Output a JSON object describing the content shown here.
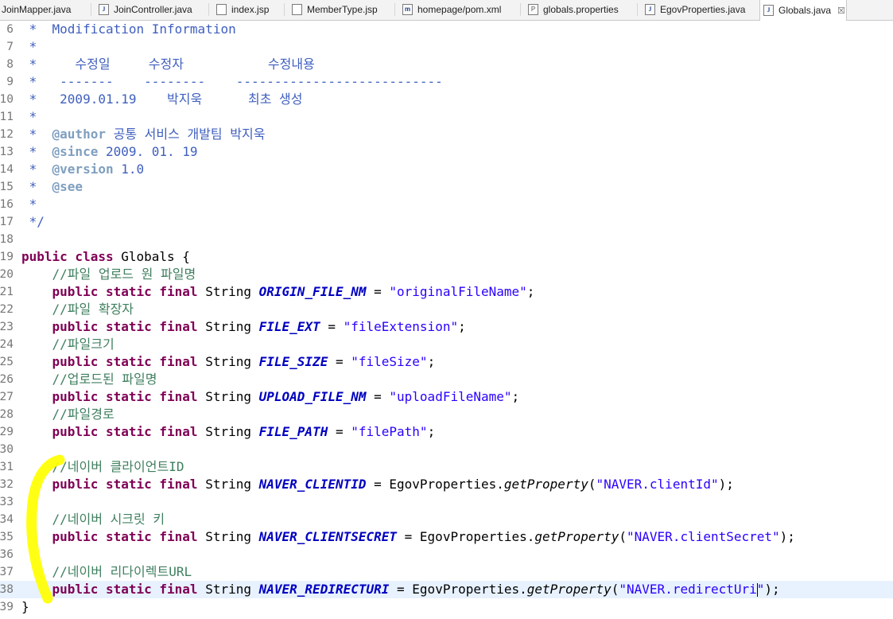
{
  "tabs": [
    {
      "label": "JoinMapper.java",
      "icon": "java-file-icon",
      "kind": "java",
      "active": false
    },
    {
      "label": "JoinController.java",
      "icon": "java-file-icon",
      "kind": "java",
      "active": false
    },
    {
      "label": "index.jsp",
      "icon": "jsp-file-icon",
      "kind": "jsp",
      "active": false
    },
    {
      "label": "MemberType.jsp",
      "icon": "jsp-file-icon",
      "kind": "jsp",
      "active": false
    },
    {
      "label": "homepage/pom.xml",
      "icon": "maven-file-icon",
      "kind": "maven",
      "active": false
    },
    {
      "label": "globals.properties",
      "icon": "properties-file-icon",
      "kind": "props",
      "active": false
    },
    {
      "label": "EgovProperties.java",
      "icon": "java-file-icon",
      "kind": "java",
      "active": false
    },
    {
      "label": "Globals.java",
      "icon": "java-file-icon",
      "kind": "java",
      "active": true,
      "close": "☒"
    }
  ],
  "editor": {
    "current_line": "38",
    "caret_after": "NAVER.redirectUri",
    "annotation_color": "#ffff00",
    "lines": [
      {
        "n": "6",
        "tokens": [
          {
            "t": " *  ",
            "c": "cm"
          },
          {
            "t": "Modification Information",
            "c": "cm"
          }
        ]
      },
      {
        "n": "7",
        "tokens": [
          {
            "t": " *",
            "c": "cm"
          }
        ]
      },
      {
        "n": "8",
        "tokens": [
          {
            "t": " *     수정일     수정자           수정내용",
            "c": "cm"
          }
        ]
      },
      {
        "n": "9",
        "tokens": [
          {
            "t": " *   -------    --------    ---------------------------",
            "c": "cm"
          }
        ]
      },
      {
        "n": "10",
        "tokens": [
          {
            "t": " *   2009.01.19    박지욱      최초 생성",
            "c": "cm"
          }
        ]
      },
      {
        "n": "11",
        "tokens": [
          {
            "t": " *",
            "c": "cm"
          }
        ]
      },
      {
        "n": "12",
        "tokens": [
          {
            "t": " *  ",
            "c": "cm"
          },
          {
            "t": "@author",
            "c": "ct"
          },
          {
            "t": " 공통 서비스 개발팀 박지욱",
            "c": "cm"
          }
        ]
      },
      {
        "n": "13",
        "tokens": [
          {
            "t": " *  ",
            "c": "cm"
          },
          {
            "t": "@since",
            "c": "ct"
          },
          {
            "t": " 2009. 01. 19",
            "c": "cm"
          }
        ]
      },
      {
        "n": "14",
        "tokens": [
          {
            "t": " *  ",
            "c": "cm"
          },
          {
            "t": "@version",
            "c": "ct"
          },
          {
            "t": " 1.0",
            "c": "cm"
          }
        ]
      },
      {
        "n": "15",
        "tokens": [
          {
            "t": " *  ",
            "c": "cm"
          },
          {
            "t": "@see",
            "c": "ct"
          }
        ]
      },
      {
        "n": "16",
        "tokens": [
          {
            "t": " *",
            "c": "cm"
          }
        ]
      },
      {
        "n": "17",
        "tokens": [
          {
            "t": " */",
            "c": "cm"
          }
        ]
      },
      {
        "n": "18",
        "tokens": []
      },
      {
        "n": "19",
        "tokens": [
          {
            "t": "public class",
            "c": "kw"
          },
          {
            "t": " Globals {",
            "c": "pl"
          }
        ]
      },
      {
        "n": "20",
        "tokens": [
          {
            "t": "    //파일 업로드 원 파일명",
            "c": "lc"
          }
        ]
      },
      {
        "n": "21",
        "tokens": [
          {
            "t": "    ",
            "c": "pl"
          },
          {
            "t": "public static final",
            "c": "kw"
          },
          {
            "t": " String ",
            "c": "pl"
          },
          {
            "t": "ORIGIN_FILE_NM",
            "c": "fd"
          },
          {
            "t": " = ",
            "c": "pl"
          },
          {
            "t": "\"originalFileName\"",
            "c": "st"
          },
          {
            "t": ";",
            "c": "pl"
          }
        ]
      },
      {
        "n": "22",
        "tokens": [
          {
            "t": "    //파일 확장자",
            "c": "lc"
          }
        ]
      },
      {
        "n": "23",
        "tokens": [
          {
            "t": "    ",
            "c": "pl"
          },
          {
            "t": "public static final",
            "c": "kw"
          },
          {
            "t": " String ",
            "c": "pl"
          },
          {
            "t": "FILE_EXT",
            "c": "fd"
          },
          {
            "t": " = ",
            "c": "pl"
          },
          {
            "t": "\"fileExtension\"",
            "c": "st"
          },
          {
            "t": ";",
            "c": "pl"
          }
        ]
      },
      {
        "n": "24",
        "tokens": [
          {
            "t": "    //파일크기",
            "c": "lc"
          }
        ]
      },
      {
        "n": "25",
        "tokens": [
          {
            "t": "    ",
            "c": "pl"
          },
          {
            "t": "public static final",
            "c": "kw"
          },
          {
            "t": " String ",
            "c": "pl"
          },
          {
            "t": "FILE_SIZE",
            "c": "fd"
          },
          {
            "t": " = ",
            "c": "pl"
          },
          {
            "t": "\"fileSize\"",
            "c": "st"
          },
          {
            "t": ";",
            "c": "pl"
          }
        ]
      },
      {
        "n": "26",
        "tokens": [
          {
            "t": "    //업로드된 파일명",
            "c": "lc"
          }
        ]
      },
      {
        "n": "27",
        "tokens": [
          {
            "t": "    ",
            "c": "pl"
          },
          {
            "t": "public static final",
            "c": "kw"
          },
          {
            "t": " String ",
            "c": "pl"
          },
          {
            "t": "UPLOAD_FILE_NM",
            "c": "fd"
          },
          {
            "t": " = ",
            "c": "pl"
          },
          {
            "t": "\"uploadFileName\"",
            "c": "st"
          },
          {
            "t": ";",
            "c": "pl"
          }
        ]
      },
      {
        "n": "28",
        "tokens": [
          {
            "t": "    //파일경로",
            "c": "lc"
          }
        ]
      },
      {
        "n": "29",
        "tokens": [
          {
            "t": "    ",
            "c": "pl"
          },
          {
            "t": "public static final",
            "c": "kw"
          },
          {
            "t": " String ",
            "c": "pl"
          },
          {
            "t": "FILE_PATH",
            "c": "fd"
          },
          {
            "t": " = ",
            "c": "pl"
          },
          {
            "t": "\"filePath\"",
            "c": "st"
          },
          {
            "t": ";",
            "c": "pl"
          }
        ]
      },
      {
        "n": "30",
        "tokens": []
      },
      {
        "n": "31",
        "tokens": [
          {
            "t": "    //네이버 클라이언트ID",
            "c": "lc"
          }
        ]
      },
      {
        "n": "32",
        "tokens": [
          {
            "t": "    ",
            "c": "pl"
          },
          {
            "t": "public static final",
            "c": "kw"
          },
          {
            "t": " String ",
            "c": "pl"
          },
          {
            "t": "NAVER_CLIENTID",
            "c": "fd"
          },
          {
            "t": " = EgovProperties.",
            "c": "pl"
          },
          {
            "t": "getProperty",
            "c": "mt"
          },
          {
            "t": "(",
            "c": "pl"
          },
          {
            "t": "\"NAVER.clientId\"",
            "c": "st"
          },
          {
            "t": ");",
            "c": "pl"
          }
        ]
      },
      {
        "n": "33",
        "tokens": []
      },
      {
        "n": "34",
        "tokens": [
          {
            "t": "    //네이버 시크릿 키",
            "c": "lc"
          }
        ]
      },
      {
        "n": "35",
        "tokens": [
          {
            "t": "    ",
            "c": "pl"
          },
          {
            "t": "public static final",
            "c": "kw"
          },
          {
            "t": " String ",
            "c": "pl"
          },
          {
            "t": "NAVER_CLIENTSECRET",
            "c": "fd"
          },
          {
            "t": " = EgovProperties.",
            "c": "pl"
          },
          {
            "t": "getProperty",
            "c": "mt"
          },
          {
            "t": "(",
            "c": "pl"
          },
          {
            "t": "\"NAVER.clientSecret\"",
            "c": "st"
          },
          {
            "t": ");",
            "c": "pl"
          }
        ]
      },
      {
        "n": "36",
        "tokens": []
      },
      {
        "n": "37",
        "tokens": [
          {
            "t": "    //네이버 리다이렉트URL",
            "c": "lc"
          }
        ]
      },
      {
        "n": "38",
        "tokens": [
          {
            "t": "    ",
            "c": "pl"
          },
          {
            "t": "public static final",
            "c": "kw"
          },
          {
            "t": " String ",
            "c": "pl"
          },
          {
            "t": "NAVER_REDIRECTURI",
            "c": "fd"
          },
          {
            "t": " = EgovProperties.",
            "c": "pl"
          },
          {
            "t": "getProperty",
            "c": "mt"
          },
          {
            "t": "(",
            "c": "pl"
          },
          {
            "t": "\"NAVER.redirectUri",
            "c": "st"
          },
          {
            "t": "caret",
            "c": "caret"
          },
          {
            "t": "\"",
            "c": "st"
          },
          {
            "t": ");",
            "c": "pl"
          }
        ]
      },
      {
        "n": "39",
        "tokens": [
          {
            "t": "}",
            "c": "pl"
          }
        ]
      }
    ]
  }
}
